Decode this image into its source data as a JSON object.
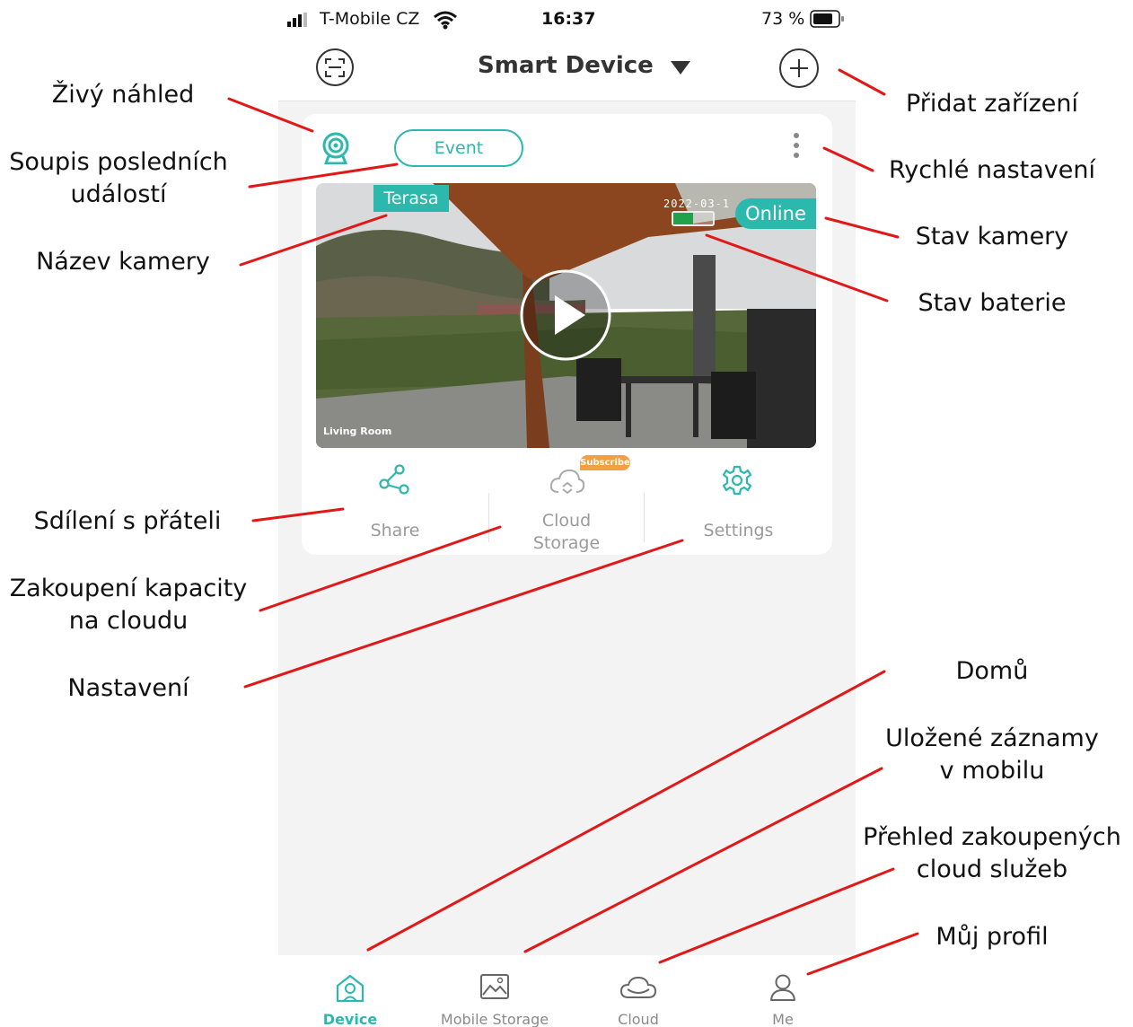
{
  "status_bar": {
    "carrier": "T-Mobile CZ",
    "time": "16:37",
    "battery": "73 %"
  },
  "nav": {
    "title": "Smart Device"
  },
  "card": {
    "event_label": "Event",
    "camera_name": "Terasa",
    "status": "Online",
    "timestamp_overlay": "2022-03-1",
    "watermark": "Living Room",
    "actions": {
      "share": "Share",
      "cloud_line1": "Cloud",
      "cloud_line2": "Storage",
      "subscribe_badge": "Subscribe",
      "settings": "Settings"
    }
  },
  "tabs": [
    {
      "label": "Device",
      "active": true
    },
    {
      "label": "Mobile Storage",
      "active": false
    },
    {
      "label": "Cloud",
      "active": false
    },
    {
      "label": "Me",
      "active": false
    }
  ],
  "annotations": {
    "live_preview": "Živý náhled",
    "events_line1": "Soupis posledních",
    "events_line2": "událostí",
    "camera_name": "Název kamery",
    "add_device": "Přidat zařízení",
    "quick_settings": "Rychlé nastavení",
    "camera_status": "Stav kamery",
    "battery_status": "Stav baterie",
    "share": "Sdílení s přáteli",
    "cloud_line1": "Zakoupení kapacity",
    "cloud_line2": "na cloudu",
    "settings": "Nastavení",
    "home": "Domů",
    "mobile_storage_line1": "Uložené záznamy",
    "mobile_storage_line2": "v mobilu",
    "cloud_services_line1": "Přehled zakoupených",
    "cloud_services_line2": "cloud služeb",
    "profile": "Můj profil"
  },
  "colors": {
    "accent": "#2db8ae",
    "annotation_line": "#e01818",
    "subscribe": "#f0a040"
  }
}
